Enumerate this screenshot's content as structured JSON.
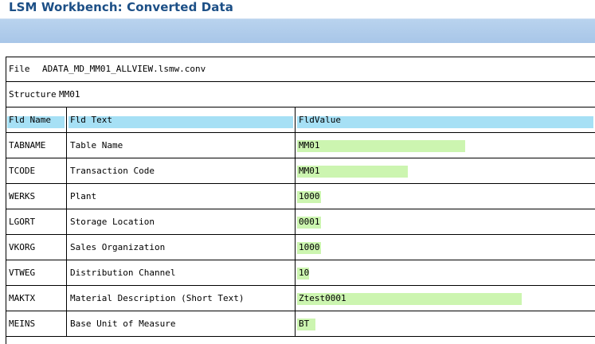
{
  "window": {
    "title": "LSM Workbench: Converted Data"
  },
  "file": {
    "label": "File",
    "value": "ADATA_MD_MM01_ALLVIEW.lsmw.conv"
  },
  "structure": {
    "label": "Structure",
    "value": "MM01"
  },
  "columns": {
    "fld_name": "Fld Name",
    "fld_text": "Fld Text",
    "fld_value": "FldValue"
  },
  "colors": {
    "title": "#1c4f86",
    "toolbar": "#a8c6e8",
    "header_highlight": "#a6e0f5",
    "value_highlight": "#ccf5b0"
  },
  "rows": [
    {
      "name": "TABNAME",
      "text": "Table Name",
      "value": "MM01",
      "fill": 0.56
    },
    {
      "name": "TCODE",
      "text": "Transaction Code",
      "value": "MM01",
      "fill": 0.37
    },
    {
      "name": "WERKS",
      "text": "Plant",
      "value": "1000",
      "fill": 0.08
    },
    {
      "name": "LGORT",
      "text": "Storage Location",
      "value": "0001",
      "fill": 0.08
    },
    {
      "name": "VKORG",
      "text": "Sales Organization",
      "value": "1000",
      "fill": 0.08
    },
    {
      "name": "VTWEG",
      "text": "Distribution Channel",
      "value": "10",
      "fill": 0.04
    },
    {
      "name": "MAKTX",
      "text": "Material Description (Short Text)",
      "value": "Ztest0001",
      "fill": 0.75
    },
    {
      "name": "MEINS",
      "text": "Base Unit of Measure",
      "value": "BT",
      "fill": 0.06
    }
  ]
}
